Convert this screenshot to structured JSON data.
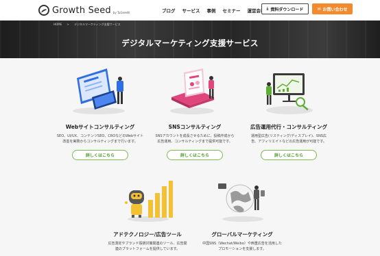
{
  "header": {
    "logo_text": "Growth Seed",
    "logo_by": "by TuGeeeN",
    "nav": [
      "ブログ",
      "サービス",
      "事例",
      "セミナー",
      "運営会社"
    ],
    "download_label": "資料ダウンロード",
    "contact_label": "お問い合わせ"
  },
  "hero": {
    "breadcrumb_home": "HOME",
    "breadcrumb_sep": ">",
    "breadcrumb_current": "デジタルマーケティング支援サービス",
    "title": "デジタルマーケティング支援サービス"
  },
  "services": [
    {
      "title": "Webサイトコンサルティング",
      "desc": "SEO、UI/UX、コンテンツSEO、CROなどのWebサイト\n改善を実務からコンサルティングまで行います。",
      "button": "詳しくはこちら"
    },
    {
      "title": "SNSコンサルティング",
      "desc": "SNSアカウントを成長させるために、投稿作成から\n広告運用、コンサルティングまで提供可能です。",
      "button": "詳しくはこちら"
    },
    {
      "title": "広告運用代行・コンサルティング",
      "desc": "運用型広告(リスティング/ディスプレイ)、SNS広\n告、アフィリエイトなどの広告運用が可能です。",
      "button": "詳しくはこちら"
    },
    {
      "title": "アドテクノロジー/広告ツール",
      "desc": "広告測定やブランド毀損対策関連のツール、広告関\n連のプラットフォームを提供しています。"
    },
    {
      "title": "グローバルマーケティング",
      "desc": "中国SNS（Wechat/Weibo）や西重広告を活用した\nプロモーションを支援します。"
    }
  ],
  "colors": {
    "accent_orange": "#f28a2e",
    "accent_green": "#7dbb4c",
    "hero_dark": "#2d2d2d",
    "content_bg": "#f6f6f6"
  }
}
